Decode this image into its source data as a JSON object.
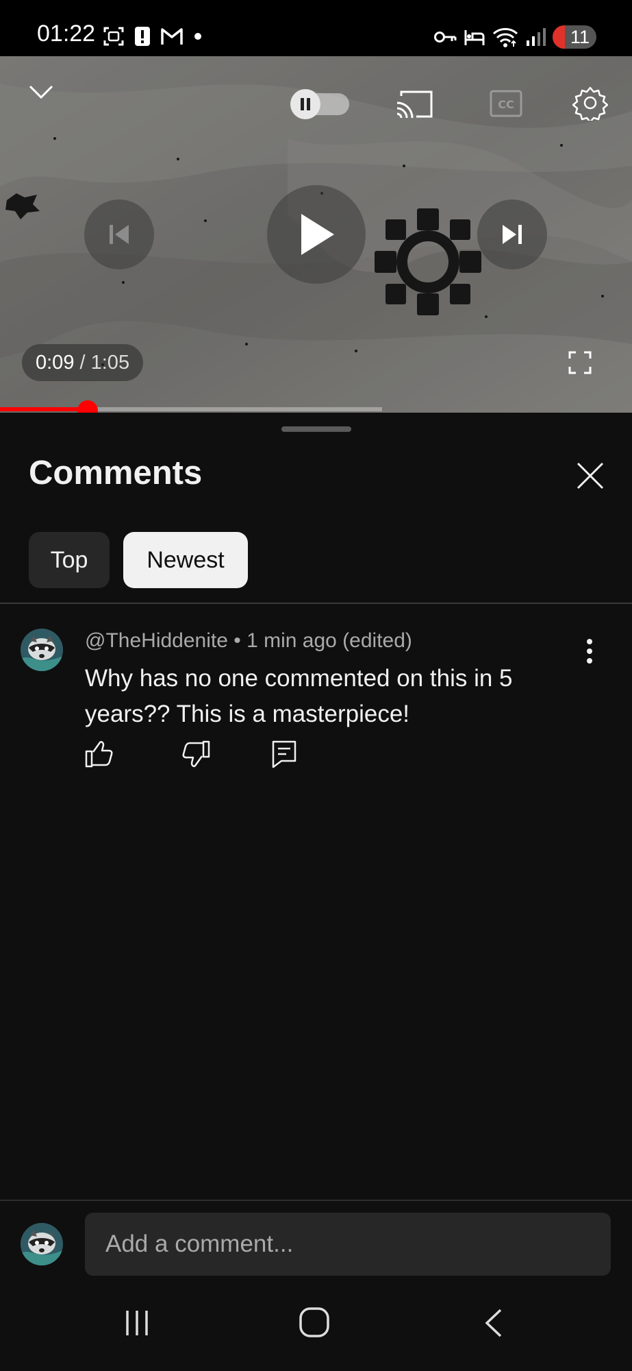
{
  "status_bar": {
    "time": "01:22",
    "battery": "11",
    "left_icons": [
      "screenshot-icon",
      "alert-icon",
      "gmail-icon",
      "dot-icon"
    ],
    "right_icons": [
      "key-icon",
      "bed-icon",
      "wifi-icon",
      "signal-icon",
      "battery-icon"
    ]
  },
  "player": {
    "current_time": "0:09",
    "separator": " / ",
    "duration": "1:05",
    "progress_fraction": 0.1385,
    "buffered_fraction": 0.6045,
    "autoplay_on": false,
    "controls": [
      "collapse-icon",
      "autoplay-toggle",
      "cast-icon",
      "captions-icon",
      "settings-icon",
      "previous-icon",
      "play-icon",
      "next-icon",
      "fullscreen-icon"
    ]
  },
  "comments": {
    "title": "Comments",
    "chips": [
      {
        "label": "Top",
        "selected": false
      },
      {
        "label": "Newest",
        "selected": true
      }
    ],
    "items": [
      {
        "author": "@TheHiddenite",
        "meta_separator": " • ",
        "time": "1 min ago (edited)",
        "text": "Why has no one commented on this in 5 years?? This is a masterpiece!"
      }
    ],
    "composer_placeholder": "Add a comment..."
  },
  "colors": {
    "background": "#0f0f0f",
    "accent_red": "#ff0000",
    "chip_selected_bg": "#f1f1f1",
    "chip_bg": "#272727"
  }
}
